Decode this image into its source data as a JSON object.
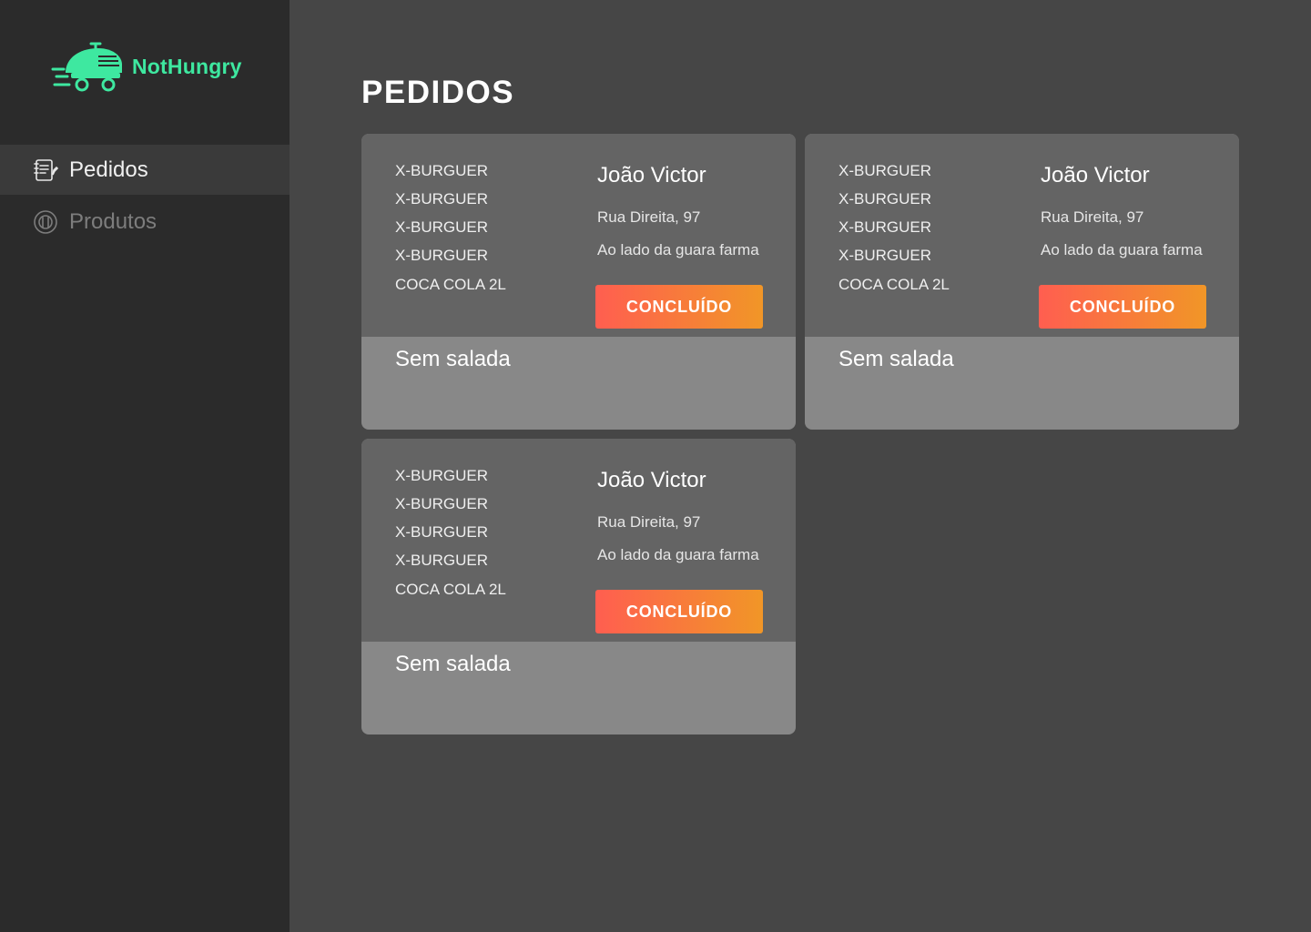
{
  "brand": {
    "name": "NotHungry",
    "accent_color": "#3ee8a0",
    "logo_icon": "delivery-scooter-icon"
  },
  "sidebar": {
    "items": [
      {
        "label": "Pedidos",
        "icon": "notepad-icon",
        "active": true
      },
      {
        "label": "Produtos",
        "icon": "cutlery-plate-icon",
        "active": false
      }
    ]
  },
  "main": {
    "title": "PEDIDOS",
    "orders": [
      {
        "items": [
          "X-BURGUER",
          "X-BURGUER",
          "X-BURGUER",
          "X-BURGUER",
          "COCA COLA 2L"
        ],
        "customer": "João Victor",
        "address": "Rua Direita, 97",
        "reference": "Ao lado da guara farma",
        "button_label": "CONCLUÍDO",
        "note": "Sem salada"
      },
      {
        "items": [
          "X-BURGUER",
          "X-BURGUER",
          "X-BURGUER",
          "X-BURGUER",
          "COCA COLA 2L"
        ],
        "customer": "João Victor",
        "address": "Rua Direita, 97",
        "reference": "Ao lado da guara farma",
        "button_label": "CONCLUÍDO",
        "note": "Sem salada"
      },
      {
        "items": [
          "X-BURGUER",
          "X-BURGUER",
          "X-BURGUER",
          "X-BURGUER",
          "COCA COLA 2L"
        ],
        "customer": "João Victor",
        "address": "Rua Direita, 97",
        "reference": "Ao lado da guara farma",
        "button_label": "CONCLUÍDO",
        "note": "Sem salada"
      }
    ]
  },
  "colors": {
    "button_gradient_start": "#ff5e50",
    "button_gradient_end": "#f19627"
  }
}
